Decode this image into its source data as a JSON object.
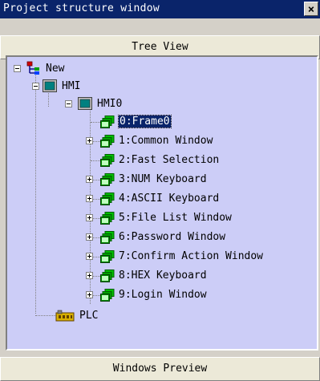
{
  "window": {
    "title": "Project structure window",
    "close_symbol": "×"
  },
  "tabs": {
    "tree_view": "Tree View",
    "windows_preview": "Windows Preview"
  },
  "tree": {
    "root": "New",
    "hmi": "HMI",
    "hmi0": "HMI0",
    "frames": [
      {
        "label": "0:Frame0",
        "selected": true,
        "expandable": false
      },
      {
        "label": "1:Common Window",
        "selected": false,
        "expandable": true
      },
      {
        "label": "2:Fast Selection",
        "selected": false,
        "expandable": false
      },
      {
        "label": "3:NUM Keyboard",
        "selected": false,
        "expandable": true
      },
      {
        "label": "4:ASCII Keyboard",
        "selected": false,
        "expandable": true
      },
      {
        "label": "5:File List Window",
        "selected": false,
        "expandable": true
      },
      {
        "label": "6:Password Window",
        "selected": false,
        "expandable": true
      },
      {
        "label": "7:Confirm Action Window",
        "selected": false,
        "expandable": true
      },
      {
        "label": "8:HEX Keyboard",
        "selected": false,
        "expandable": true
      },
      {
        "label": "9:Login Window",
        "selected": false,
        "expandable": true
      }
    ],
    "plc": "PLC"
  },
  "colors": {
    "titlebar": "#0a246a",
    "tree_background": "#cccdf7",
    "selection": "#0a246a",
    "window_icon": "#00a000",
    "plc_icon": "#c8a000"
  }
}
